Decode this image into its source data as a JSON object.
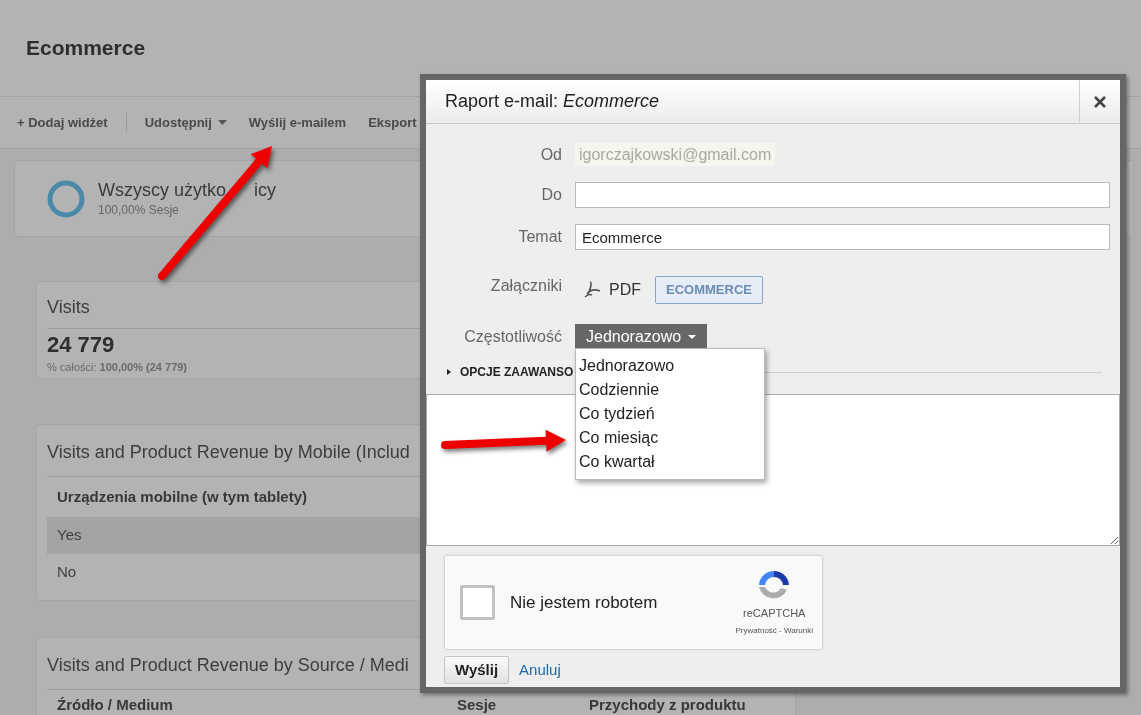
{
  "page": {
    "title": "Ecommerce",
    "toolbar": [
      {
        "label": "+ Dodaj widżet",
        "kind": "plain"
      },
      {
        "label": "Udostępnij",
        "kind": "dropdown"
      },
      {
        "label": "Wyślij e-mailem",
        "kind": "plain"
      },
      {
        "label": "Eksport",
        "kind": "plain"
      }
    ],
    "segment": {
      "name": "Wszyscy użytko",
      "name_end": "icy",
      "share": "100,00% Sesje"
    },
    "widgets": [
      {
        "kind": "metric",
        "title": "Visits",
        "value": "24 779",
        "note": "% całości: **100,00% (24 779)**"
      },
      {
        "kind": "table",
        "title": "Visits and Product Revenue by Mobile (Includ",
        "columns": [
          "Urządzenia mobilne (w tym tablety)"
        ],
        "rows": [
          {
            "cells": [
              "Yes"
            ],
            "highlighted": true
          },
          {
            "cells": [
              "No"
            ],
            "highlighted": false
          }
        ]
      },
      {
        "kind": "table",
        "title": "Visits and Product Revenue by Source / Medi",
        "columns": [
          "Źródło / Medium",
          "Sesje",
          "Przychody z produktu"
        ]
      }
    ]
  },
  "dialog": {
    "title": "Raport e-mail: *Ecommerce*",
    "from": {
      "label": "Od",
      "value": "igorczajkowski@gmail.com"
    },
    "to": {
      "label": "Do"
    },
    "subject": {
      "label": "Temat",
      "value": "Ecommerce"
    },
    "attachments": {
      "label": "Załączniki",
      "format": "PDF",
      "items": [
        {
          "label": "ECOMMERCE",
          "selected": true
        }
      ]
    },
    "frequency": {
      "label": "Częstotliwość",
      "value": "Jednorazowo",
      "expanded": true,
      "options": [
        "Jednorazowo",
        "Codziennie",
        "Co tydzień",
        "Co miesiąc",
        "Co kwartał"
      ]
    },
    "advanced": {
      "label": "OPCJE ZAAWANSO",
      "expanded": false
    },
    "captcha": {
      "label": "Nie jestem robotem",
      "checked": false,
      "brand": "reCAPTCHA",
      "links": "Prywatność - Warunki"
    },
    "buttons": [
      {
        "label": "Wyślij",
        "kind": "primary"
      },
      {
        "label": "Anuluj",
        "kind": "link"
      }
    ]
  }
}
